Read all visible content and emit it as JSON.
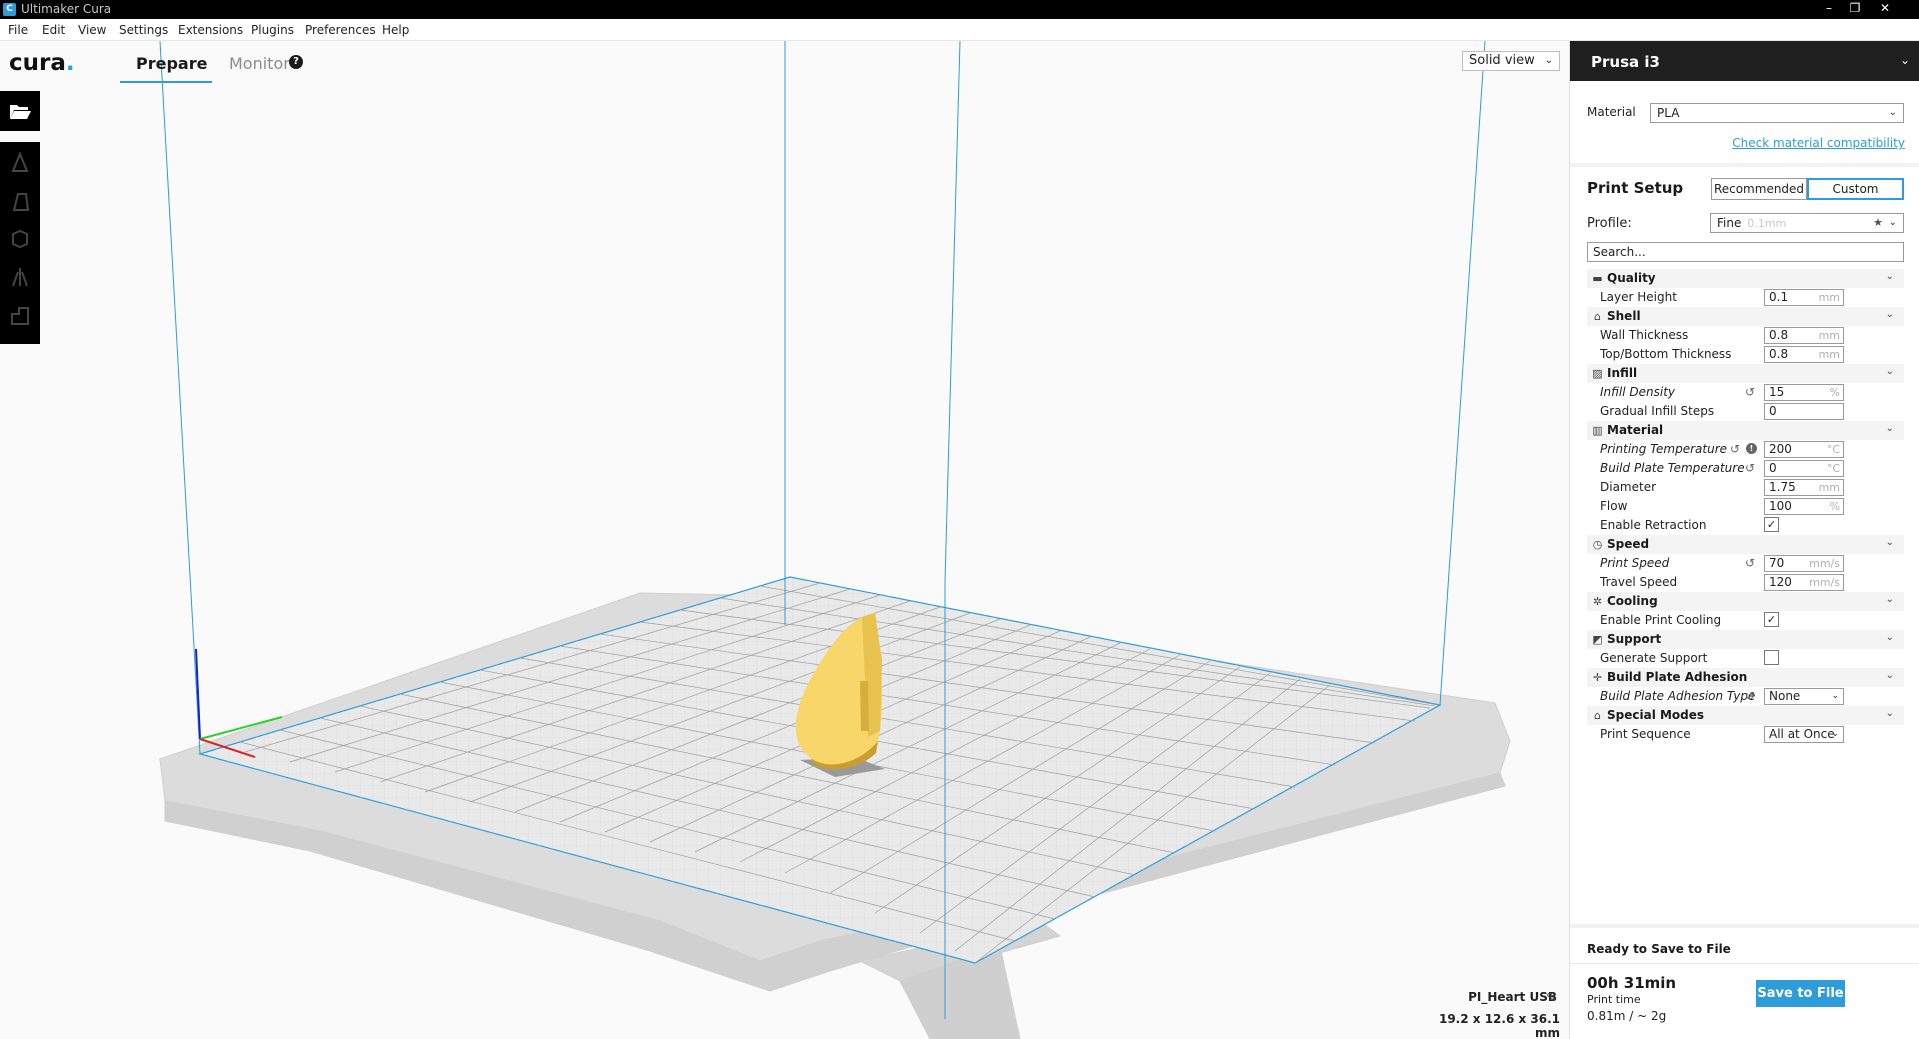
{
  "window": {
    "title": "Ultimaker Cura",
    "controls": [
      "–",
      "❐",
      "✕"
    ]
  },
  "menubar": [
    "File",
    "Edit",
    "View",
    "Settings",
    "Extensions",
    "Plugins",
    "Preferences",
    "Help"
  ],
  "header": {
    "logo_text": "cura",
    "logo_dot": ".",
    "tabs": {
      "prepare": "Prepare",
      "monitor": "Monitor"
    },
    "help_glyph": "?",
    "view_mode": "Solid view"
  },
  "toolbar": {
    "open_icon": "folder-open-icon",
    "tools": [
      "translate-icon",
      "scale-icon",
      "rotate-icon",
      "mirror-icon",
      "per-model-settings-icon"
    ]
  },
  "object": {
    "name": "PI_Heart USB",
    "dimensions": "19.2 x 12.6 x 36.1 mm"
  },
  "sidebar": {
    "printer": "Prusa i3",
    "material_label": "Material",
    "material_value": "PLA",
    "check_compat": "Check material compatibility",
    "print_setup": "Print Setup",
    "modes": {
      "recommended": "Recommended",
      "custom": "Custom"
    },
    "profile_label": "Profile:",
    "profile_value": "Fine",
    "profile_sub": "0.1mm",
    "search_placeholder": "Search...",
    "categories": [
      {
        "name": "Quality",
        "icon": "quality-icon",
        "glyph": "▬",
        "rows": [
          {
            "name": "Layer Height",
            "value": "0.1",
            "unit": "mm",
            "type": "field"
          }
        ]
      },
      {
        "name": "Shell",
        "icon": "shell-icon",
        "glyph": "⌂",
        "rows": [
          {
            "name": "Wall Thickness",
            "value": "0.8",
            "unit": "mm",
            "type": "field"
          },
          {
            "name": "Top/Bottom Thickness",
            "value": "0.8",
            "unit": "mm",
            "type": "field"
          }
        ]
      },
      {
        "name": "Infill",
        "icon": "infill-icon",
        "glyph": "▨",
        "rows": [
          {
            "name": "Infill Density",
            "value": "15",
            "unit": "%",
            "type": "field",
            "italic": true,
            "reset": true
          },
          {
            "name": "Gradual Infill Steps",
            "value": "0",
            "unit": "",
            "type": "field"
          }
        ]
      },
      {
        "name": "Material",
        "icon": "material-icon",
        "glyph": "▥",
        "rows": [
          {
            "name": "Printing Temperature",
            "value": "200",
            "unit": "°C",
            "type": "field",
            "italic": true,
            "reset": true,
            "info": true
          },
          {
            "name": "Build Plate Temperature",
            "value": "0",
            "unit": "°C",
            "type": "field",
            "italic": true,
            "reset": true
          },
          {
            "name": "Diameter",
            "value": "1.75",
            "unit": "mm",
            "type": "field"
          },
          {
            "name": "Flow",
            "value": "100",
            "unit": "%",
            "type": "field"
          },
          {
            "name": "Enable Retraction",
            "value": "✓",
            "unit": "",
            "type": "check"
          }
        ]
      },
      {
        "name": "Speed",
        "icon": "speed-icon",
        "glyph": "◷",
        "rows": [
          {
            "name": "Print Speed",
            "value": "70",
            "unit": "mm/s",
            "type": "field",
            "italic": true,
            "reset": true
          },
          {
            "name": "Travel Speed",
            "value": "120",
            "unit": "mm/s",
            "type": "field"
          }
        ]
      },
      {
        "name": "Cooling",
        "icon": "cooling-icon",
        "glyph": "✲",
        "rows": [
          {
            "name": "Enable Print Cooling",
            "value": "✓",
            "unit": "",
            "type": "check"
          }
        ]
      },
      {
        "name": "Support",
        "icon": "support-icon",
        "glyph": "◩",
        "rows": [
          {
            "name": "Generate Support",
            "value": "",
            "unit": "",
            "type": "check"
          }
        ]
      },
      {
        "name": "Build Plate Adhesion",
        "icon": "adhesion-icon",
        "glyph": "✛",
        "rows": [
          {
            "name": "Build Plate Adhesion Type",
            "value": "None",
            "unit": "",
            "type": "select",
            "italic": true,
            "reset": true
          }
        ]
      },
      {
        "name": "Special Modes",
        "icon": "special-modes-icon",
        "glyph": "⌂",
        "rows": [
          {
            "name": "Print Sequence",
            "value": "All at Once",
            "unit": "",
            "type": "select"
          }
        ]
      }
    ],
    "ready_label": "Ready to Save to File",
    "print_time": "00h 31min",
    "print_time_label": "Print time",
    "material_usage": "0.81m / ~ 2g",
    "save_button": "Save to File"
  },
  "colors": {
    "accent": "#2e9cd8",
    "model": "#f8d66a",
    "dark": "#1f1f1f"
  }
}
